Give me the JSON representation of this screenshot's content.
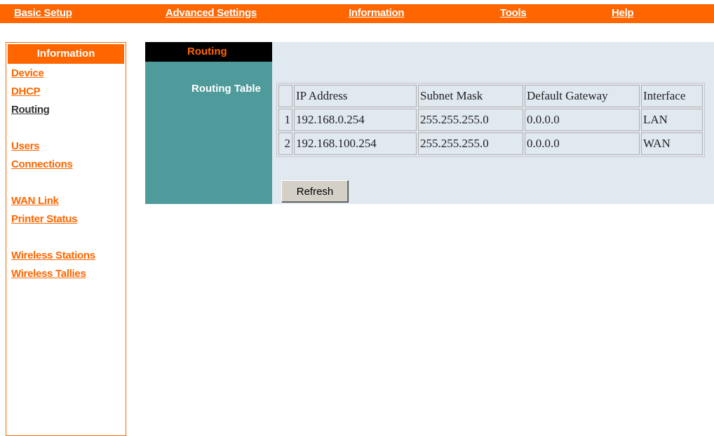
{
  "topnav": {
    "items": [
      {
        "label": "Basic Setup"
      },
      {
        "label": "Advanced Settings"
      },
      {
        "label": "Information"
      },
      {
        "label": "Tools"
      },
      {
        "label": "Help"
      }
    ]
  },
  "sidebar": {
    "title": "Information",
    "items": [
      {
        "label": "Device"
      },
      {
        "label": "DHCP"
      },
      {
        "label": "Routing"
      },
      {
        "label": "Users"
      },
      {
        "label": "Connections"
      },
      {
        "label": "WAN Link"
      },
      {
        "label": "Printer Status"
      },
      {
        "label": "Wireless Stations"
      },
      {
        "label": "Wireless Tallies"
      }
    ]
  },
  "content": {
    "tab_title": "Routing",
    "section_label": "Routing Table",
    "table": {
      "headers": [
        "IP Address",
        "Subnet Mask",
        "Default Gateway",
        "Interface"
      ],
      "rows": [
        {
          "num": "1",
          "ip": "192.168.0.254",
          "mask": "255.255.255.0",
          "gateway": "0.0.0.0",
          "iface": "LAN"
        },
        {
          "num": "2",
          "ip": "192.168.100.254",
          "mask": "255.255.255.0",
          "gateway": "0.0.0.0",
          "iface": "WAN"
        }
      ]
    },
    "refresh_label": "Refresh"
  },
  "colors": {
    "accent": "#ff6600",
    "panel": "#e0e8f0",
    "teal": "#4f9a9a"
  }
}
